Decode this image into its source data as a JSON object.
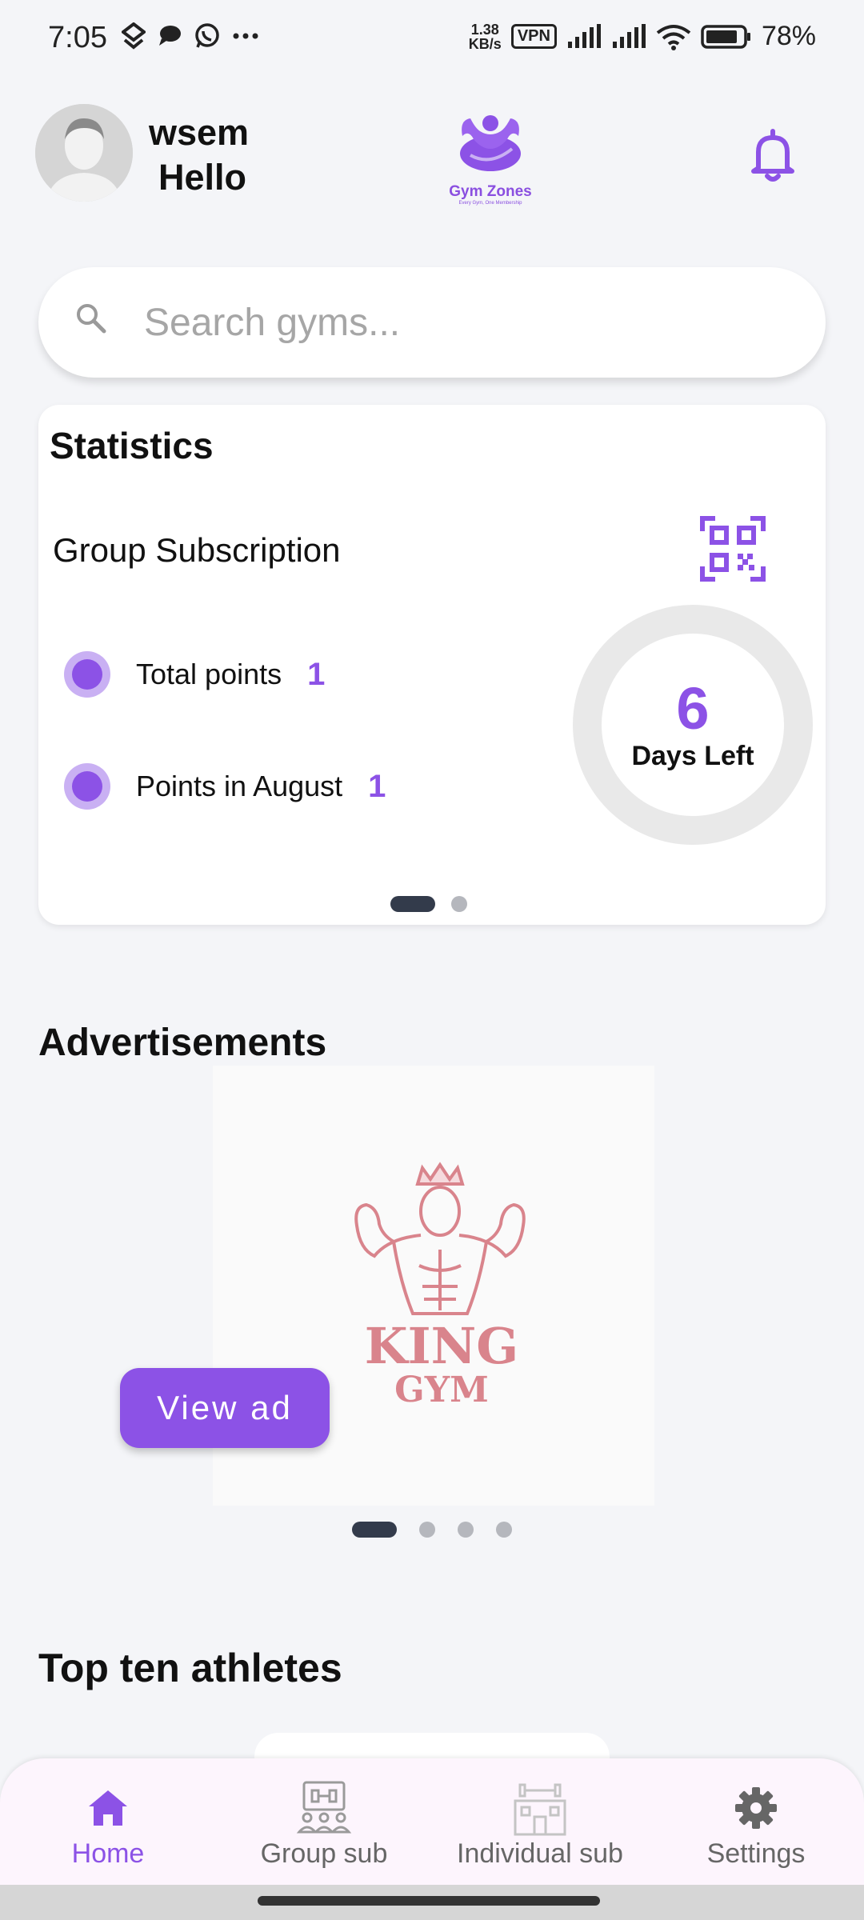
{
  "status_bar": {
    "time": "7:05",
    "speed_value": "1.38",
    "speed_unit": "KB/s",
    "vpn": "VPN",
    "battery": "78%"
  },
  "header": {
    "username": "wsem",
    "greeting": "Hello",
    "logo_text": "Gym Zones",
    "logo_tagline": "Every Gym, One Membership"
  },
  "search": {
    "placeholder": "Search gyms..."
  },
  "statistics": {
    "title": "Statistics",
    "subscription_type": "Group Subscription",
    "rows": [
      {
        "label": "Total points",
        "value": "1"
      },
      {
        "label": "Points in August",
        "value": "1"
      }
    ],
    "days_left": {
      "value": "6",
      "label": "Days Left"
    },
    "pager": {
      "pages": 2,
      "active": 0
    }
  },
  "advertisements": {
    "title": "Advertisements",
    "view_button": "View ad",
    "ad_logo_text": [
      "KING",
      "GYM"
    ],
    "pager": {
      "pages": 4,
      "active": 0
    }
  },
  "athletes": {
    "title": "Top ten athletes"
  },
  "bottom_nav": [
    {
      "label": "Home",
      "icon": "home-icon",
      "active": true
    },
    {
      "label": "Group sub",
      "icon": "group-sub-icon",
      "active": false
    },
    {
      "label": "Individual sub",
      "icon": "individual-sub-icon",
      "active": false
    },
    {
      "label": "Settings",
      "icon": "gear-icon",
      "active": false
    }
  ],
  "colors": {
    "accent": "#8c52e6",
    "background": "#f4f5f8",
    "nav_background": "#fdf5fd",
    "ad_logo": "#d9848c"
  }
}
